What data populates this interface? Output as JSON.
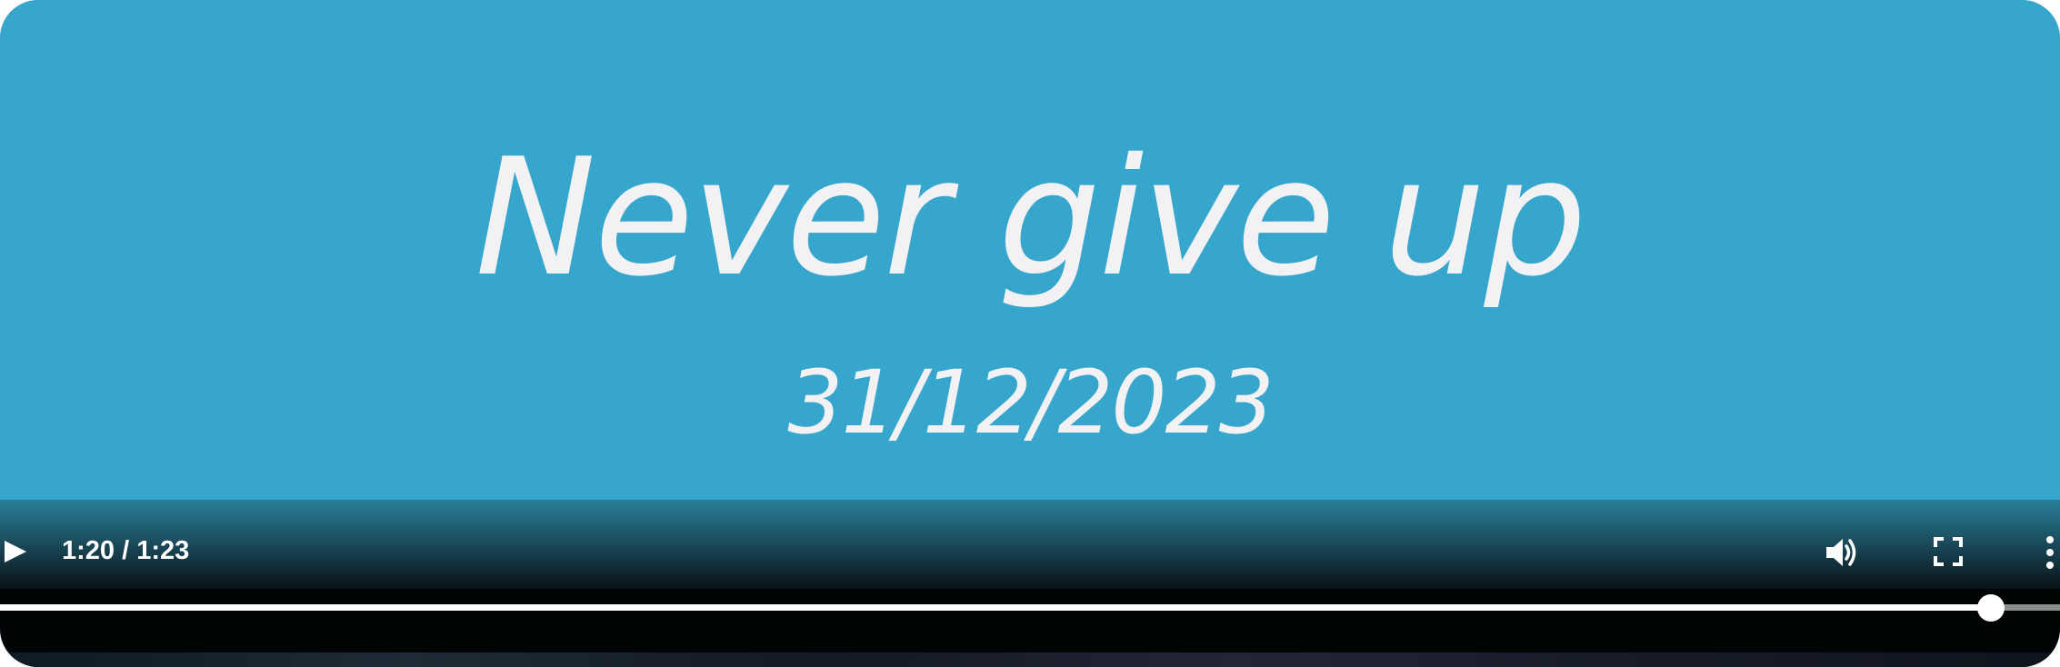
{
  "video": {
    "title_text": "Never give up",
    "date_text": "31/12/2023"
  },
  "controls": {
    "time_display": "1:20 / 1:23",
    "progress_fraction": 0.9663,
    "icons": {
      "play": "play-icon",
      "volume": "volume-icon",
      "fullscreen": "fullscreen-icon",
      "more": "more-vertical-icon"
    }
  },
  "colors": {
    "background": "#37a6cd",
    "text": "#f2f2f4",
    "controls_bar": "#010404",
    "progress": "#ffffff"
  }
}
